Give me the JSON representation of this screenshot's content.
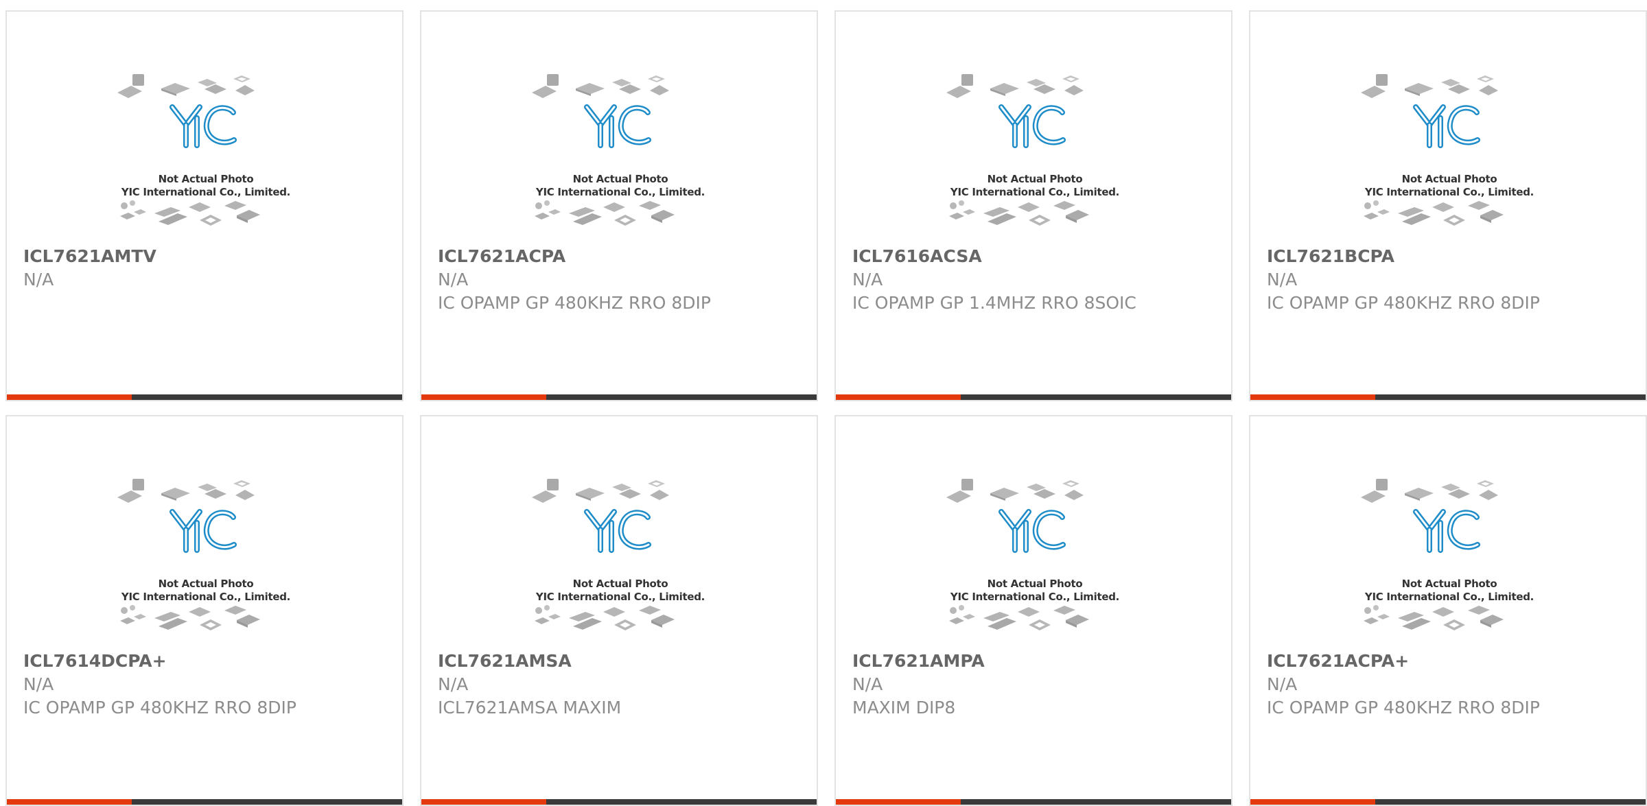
{
  "image_caption": {
    "line1": "Not Actual Photo",
    "line2": "YIC International Co., Limited."
  },
  "logo_text": "YIC",
  "colors": {
    "accent": "#e4380d",
    "bar": "#3a3a3a",
    "logo_blue": "#1d8cc9",
    "chip_gray": "#b5b5b5"
  },
  "products": [
    {
      "part": "ICL7621AMTV",
      "mfr": "N/A",
      "desc": ""
    },
    {
      "part": "ICL7621ACPA",
      "mfr": "N/A",
      "desc": "IC OPAMP GP 480KHZ RRO 8DIP"
    },
    {
      "part": "ICL7616ACSA",
      "mfr": "N/A",
      "desc": "IC OPAMP GP 1.4MHZ RRO 8SOIC"
    },
    {
      "part": "ICL7621BCPA",
      "mfr": "N/A",
      "desc": "IC OPAMP GP 480KHZ RRO 8DIP"
    },
    {
      "part": "ICL7614DCPA+",
      "mfr": "N/A",
      "desc": "IC OPAMP GP 480KHZ RRO 8DIP"
    },
    {
      "part": "ICL7621AMSA",
      "mfr": "N/A",
      "desc": "ICL7621AMSA MAXIM"
    },
    {
      "part": "ICL7621AMPA",
      "mfr": "N/A",
      "desc": "MAXIM DIP8"
    },
    {
      "part": "ICL7621ACPA+",
      "mfr": "N/A",
      "desc": "IC OPAMP GP 480KHZ RRO 8DIP"
    }
  ]
}
